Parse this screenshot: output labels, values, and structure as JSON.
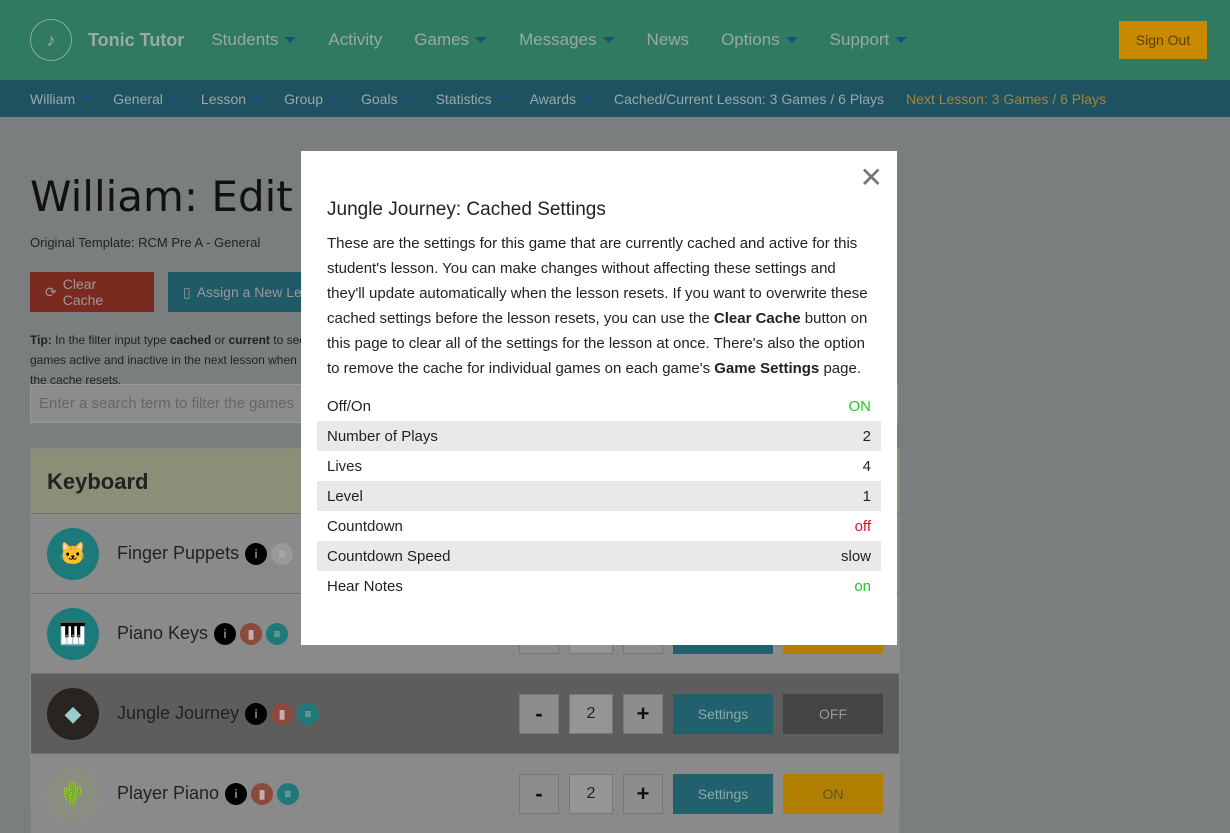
{
  "header": {
    "brand": "Tonic Tutor",
    "nav": [
      {
        "label": "Students",
        "caret": true
      },
      {
        "label": "Activity",
        "caret": false
      },
      {
        "label": "Games",
        "caret": true
      },
      {
        "label": "Messages",
        "caret": true
      },
      {
        "label": "News",
        "caret": false
      },
      {
        "label": "Options",
        "caret": true
      },
      {
        "label": "Support",
        "caret": true
      }
    ],
    "sign_out": "Sign Out"
  },
  "subnav": {
    "items": [
      "William",
      "General",
      "Lesson",
      "Group",
      "Goals",
      "Statistics",
      "Awards"
    ],
    "cached": "Cached/Current Lesson: 3 Games / 6 Plays",
    "next": "Next Lesson: 3 Games / 6 Plays"
  },
  "page": {
    "title": "William: Edit Lesson",
    "template": "Original Template: RCM Pre A - General",
    "clear_cache": "Clear Cache",
    "assign": "Assign a New Lesson",
    "tip_label": "Tip:",
    "tip_1": " In the filter input type ",
    "tip_cached": "cached",
    "tip_or": " or ",
    "tip_current": "current",
    "tip_2": " to see games active and inactive in the next lesson when the cache resets.",
    "search_placeholder": "Enter a search term to filter the games"
  },
  "section": "Keyboard",
  "games": [
    {
      "name": "Finger Puppets",
      "icon": "cat-icon",
      "plays": "",
      "toggle": "",
      "stats": false
    },
    {
      "name": "Piano Keys",
      "icon": "piano-icon",
      "plays": "2",
      "toggle": "ON",
      "stats": true
    },
    {
      "name": "Jungle Journey",
      "icon": "diamond-icon",
      "plays": "2",
      "toggle": "OFF",
      "stats": true
    },
    {
      "name": "Player Piano",
      "icon": "cactus-icon",
      "plays": "2",
      "toggle": "ON",
      "stats": true
    }
  ],
  "settings_label": "Settings",
  "modal": {
    "title": "Jungle Journey: Cached Settings",
    "p1": "These are the settings for this game that are currently cached and active for this student's lesson. You can make changes without affecting these settings and they'll update automatically when the lesson resets. If you want to overwrite these cached settings before the lesson resets, you can use the ",
    "b1": "Clear Cache",
    "p2": " button on this page to clear all of the settings for the lesson at once. There's also the option to remove the cache for individual games on each game's ",
    "b2": "Game Settings",
    "p3": " page.",
    "rows": [
      {
        "k": "Off/On",
        "v": "ON",
        "color": "#22cc22"
      },
      {
        "k": "Number of Plays",
        "v": "2",
        "color": "#222222"
      },
      {
        "k": "Lives",
        "v": "4",
        "color": "#222222"
      },
      {
        "k": "Level",
        "v": "1",
        "color": "#222222"
      },
      {
        "k": "Countdown",
        "v": "off",
        "color": "#dd1133"
      },
      {
        "k": "Countdown Speed",
        "v": "slow",
        "color": "#222222"
      },
      {
        "k": "Hear Notes",
        "v": "on",
        "color": "#22cc22"
      }
    ]
  }
}
